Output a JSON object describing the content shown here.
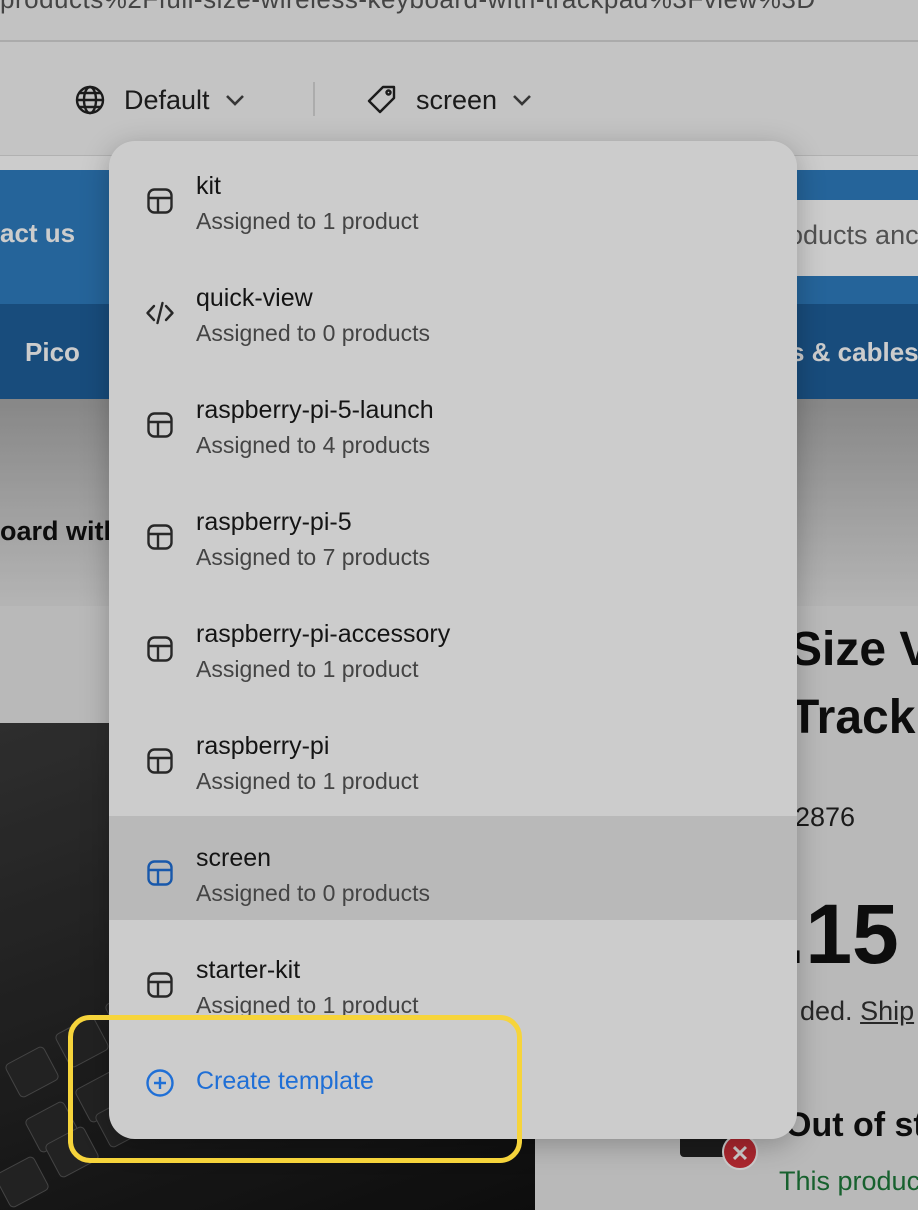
{
  "browser": {
    "url_fragment": "products%2Ffull-size-wireless-keyboard-with-trackpad%3Fview%3D"
  },
  "toolbar": {
    "language": {
      "icon": "globe-icon",
      "label": "Default"
    },
    "template": {
      "icon": "tag-icon",
      "label": "screen"
    }
  },
  "store": {
    "contact_label": "act us",
    "search_placeholder": "oducts anc",
    "nav_pico": "Pico",
    "nav_cables": "s & cables",
    "breadcrumb": "oard with"
  },
  "product": {
    "title_line1": "Size V",
    "title_line2": "Track",
    "sku": "2876",
    "price": ".15",
    "shipping_prefix": "ded. ",
    "shipping_link": "Ship",
    "stock_status": "Out of st",
    "stock_note": "This produc",
    "oos_badge": "✕"
  },
  "dropdown": {
    "options": [
      {
        "name": "kit",
        "assigned": "Assigned to 1 product",
        "icon": "layout-template-icon"
      },
      {
        "name": "quick-view",
        "assigned": "Assigned to 0 products",
        "icon": "code-icon"
      },
      {
        "name": "raspberry-pi-5-launch",
        "assigned": "Assigned to 4 products",
        "icon": "layout-template-icon"
      },
      {
        "name": "raspberry-pi-5",
        "assigned": "Assigned to 7 products",
        "icon": "layout-template-icon"
      },
      {
        "name": "raspberry-pi-accessory",
        "assigned": "Assigned to 1 product",
        "icon": "layout-template-icon"
      },
      {
        "name": "raspberry-pi",
        "assigned": "Assigned to 1 product",
        "icon": "layout-template-icon"
      },
      {
        "name": "screen",
        "assigned": "Assigned to 0 products",
        "icon": "layout-template-icon",
        "selected": true
      },
      {
        "name": "starter-kit",
        "assigned": "Assigned to 1 product",
        "icon": "layout-template-icon"
      }
    ],
    "create_label": "Create template",
    "create_icon": "plus-circle-icon"
  },
  "colors": {
    "accent_blue": "#1f6fd6",
    "highlight_yellow": "#f6d43b",
    "store_blue": "#2f7ec1",
    "store_nav_blue": "#1f5f9c"
  }
}
